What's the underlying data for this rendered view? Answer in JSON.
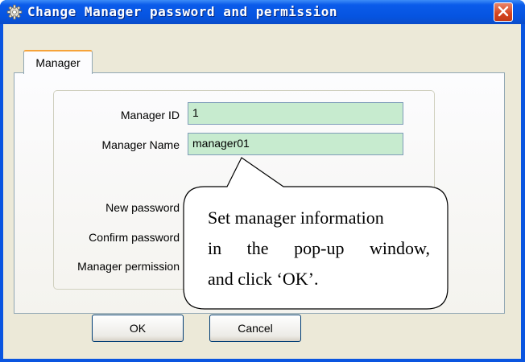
{
  "window": {
    "title": "Change Manager password and permission",
    "icon": "gear-icon",
    "close": "close-icon",
    "colors": {
      "titlebar": "#0654e0",
      "close": "#d5441f",
      "field_bg": "#c7ebcf",
      "client": "#ece9d8"
    }
  },
  "tabs": [
    {
      "label": "Manager",
      "selected": true
    }
  ],
  "form": {
    "manager_id": {
      "label": "Manager ID",
      "value": "1"
    },
    "manager_name": {
      "label": "Manager Name",
      "value": "manager01"
    },
    "new_password": {
      "label": "New password"
    },
    "confirm_password": {
      "label": "Confirm password"
    },
    "manager_permission": {
      "label": "Manager permission"
    }
  },
  "buttons": {
    "ok": "OK",
    "cancel": "Cancel"
  },
  "callout": {
    "line1": "Set manager information",
    "line2": "in the pop-up window,",
    "line3": "and click ‘OK’."
  }
}
